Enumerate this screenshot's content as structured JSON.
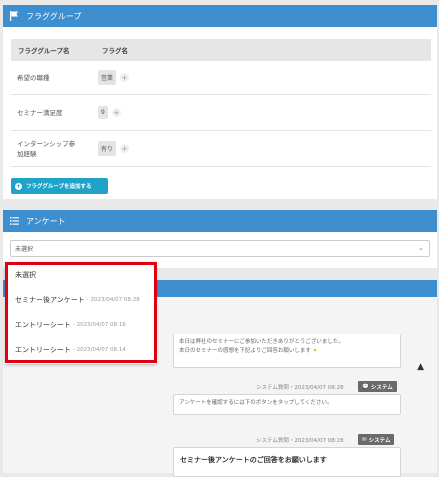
{
  "flag_panel": {
    "title": "フラググループ",
    "col_group": "フラググループ名",
    "col_flag": "フラグ名",
    "rows": [
      {
        "name": "希望の職種",
        "tag": "営業"
      },
      {
        "name": "セミナー満足度",
        "tag": "9"
      },
      {
        "name": "インターンシップ参加経験",
        "tag": "有り"
      }
    ],
    "add_button": "フラググループを追加する"
  },
  "survey_panel": {
    "title": "アンケート",
    "select_value": "未選択"
  },
  "dropdown": {
    "items": [
      {
        "label": "未選択",
        "time": ""
      },
      {
        "label": "セミナー後アンケート",
        "time": "- 2023/04/07 08:28"
      },
      {
        "label": "エントリーシート",
        "time": "- 2023/04/07 08:16"
      },
      {
        "label": "エントリーシート",
        "time": "- 2023/04/07 08:14"
      }
    ]
  },
  "chat": {
    "msg1_line1": "本日は弊社のセミナーにご参加いただきありがとうございました。",
    "msg1_line2": "本日のセミナーの感想を下記よりご回答お願いします",
    "meta1": "システム質問・2023/04/07 08:28",
    "badge1": "システム",
    "msg2": "アンケートを確認するには下のボタンをタップしてください。",
    "meta2": "システム質問・2023/04/07 08:28",
    "badge2": "システム",
    "msg3_title": "セミナー後アンケートのご回答をお願いします"
  },
  "colors": {
    "header": "#3d8fd0",
    "button": "#20a2c9",
    "highlight": "#e00012"
  }
}
